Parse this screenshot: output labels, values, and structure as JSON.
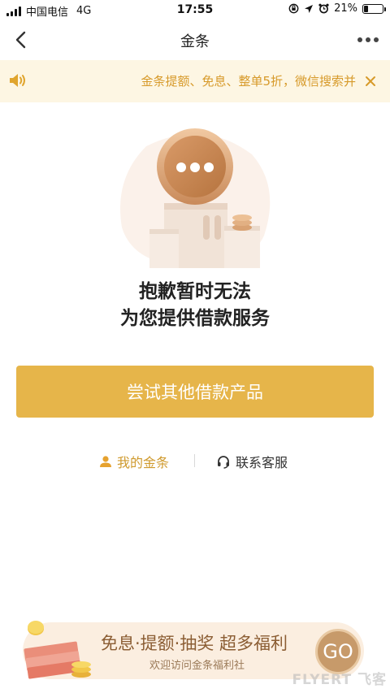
{
  "status_bar": {
    "carrier": "中国电信",
    "network": "4G",
    "time": "17:55",
    "battery": "21%",
    "battery_level": 0.21
  },
  "nav": {
    "title": "金条",
    "back_icon": "chevron-left-icon",
    "more_icon": "more-dots-icon"
  },
  "notice": {
    "text": "金条提额、免息、整单5折，微信搜索并",
    "icon": "speaker-icon",
    "close_icon": "close-icon"
  },
  "message": {
    "line1": "抱歉暂时无法",
    "line2": "为您提供借款服务"
  },
  "primary_button": {
    "label": "尝试其他借款产品"
  },
  "links": {
    "my_jintiao": "我的金条",
    "customer_service": "联系客服"
  },
  "promo": {
    "title": "免息·提额·抽奖 超多福利",
    "subtitle": "欢迎访问金条福利社",
    "go": "GO"
  },
  "watermark": "FLYERT 飞客",
  "colors": {
    "accent": "#e6b54a",
    "notice_text": "#d79a2a",
    "notice_bg": "#fdf6e3",
    "link_accent": "#cf9a2e"
  }
}
